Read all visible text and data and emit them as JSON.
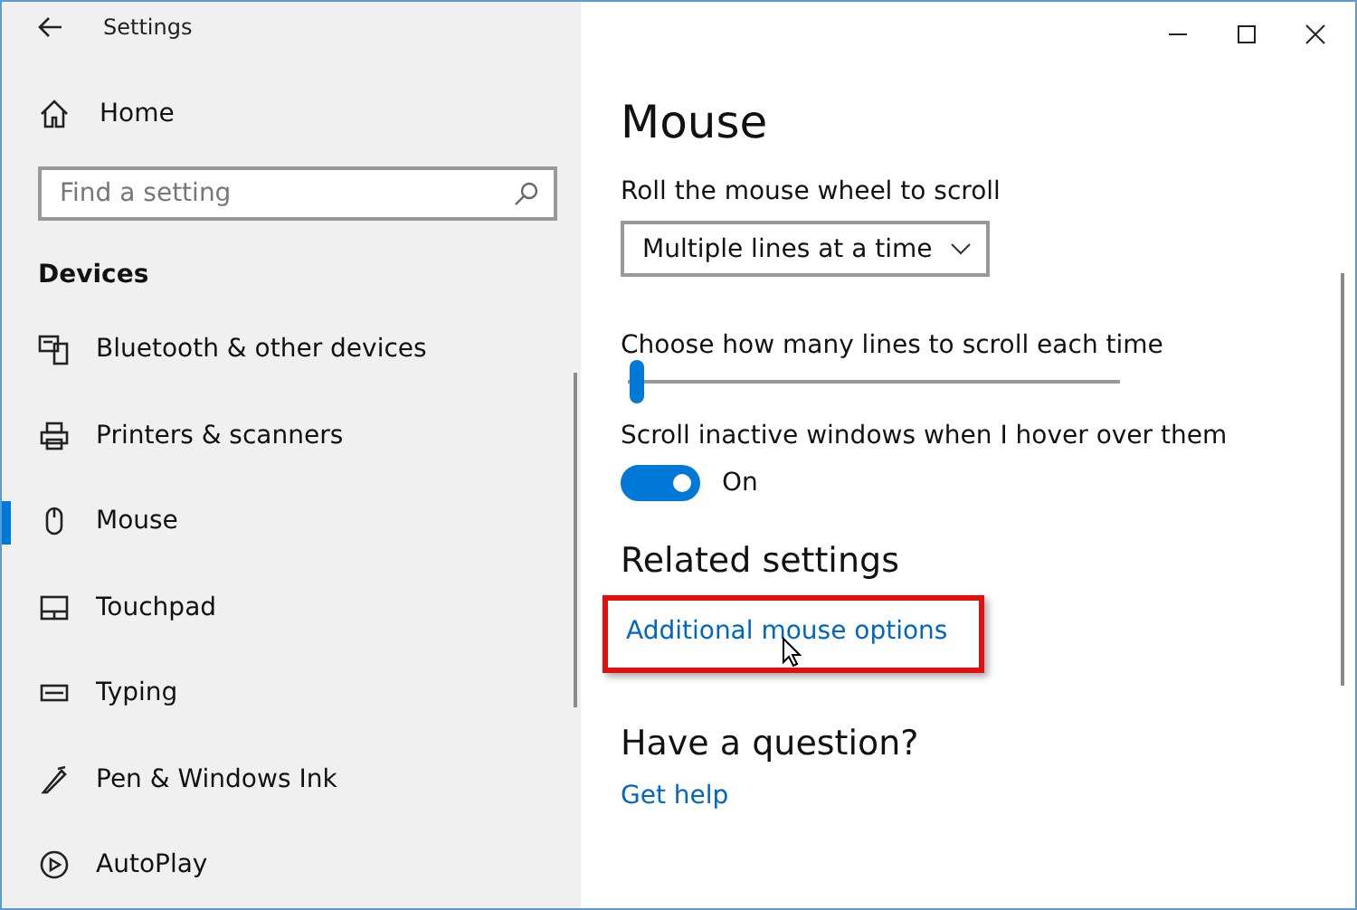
{
  "window": {
    "title": "Settings"
  },
  "sidebar": {
    "home": "Home",
    "search": {
      "placeholder": "Find a setting"
    },
    "section": "Devices",
    "items": [
      {
        "label": "Bluetooth & other devices",
        "selected": false
      },
      {
        "label": "Printers & scanners",
        "selected": false
      },
      {
        "label": "Mouse",
        "selected": true
      },
      {
        "label": "Touchpad",
        "selected": false
      },
      {
        "label": "Typing",
        "selected": false
      },
      {
        "label": "Pen & Windows Ink",
        "selected": false
      },
      {
        "label": "AutoPlay",
        "selected": false
      }
    ]
  },
  "main": {
    "title": "Mouse",
    "settings": [
      {
        "kind": "dropdown",
        "label": "Roll the mouse wheel to scroll",
        "value": "Multiple lines at a time"
      },
      {
        "kind": "slider",
        "label": "Choose how many lines to scroll each time",
        "level": 0.02
      },
      {
        "kind": "toggle",
        "label": "Scroll inactive windows when I hover over them",
        "on": true,
        "state_text": "On"
      }
    ],
    "related": {
      "heading": "Related settings",
      "links": [
        {
          "label": "Additional mouse options",
          "highlighted": true
        }
      ]
    },
    "help": {
      "heading": "Have a question?",
      "links": [
        {
          "label": "Get help"
        }
      ]
    }
  }
}
